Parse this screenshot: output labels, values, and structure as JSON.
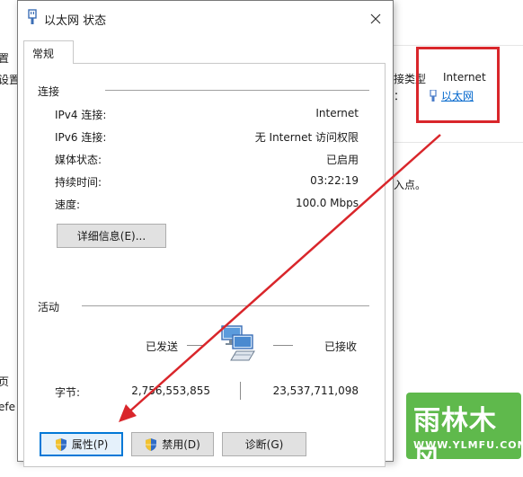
{
  "background": {
    "left_fragments": [
      "置",
      "设置"
    ],
    "left_lower_fragments": [
      "页",
      "efe"
    ],
    "right": {
      "type_label_fragment": "接类型",
      "colon_fragment": "：",
      "type_value": "Internet",
      "connection_link": "以太网",
      "hint_fragment": "入点。"
    }
  },
  "dialog": {
    "title": "以太网 状态",
    "tab": "常规",
    "connection": {
      "heading": "连接",
      "rows": [
        {
          "label": "IPv4 连接:",
          "value": "Internet"
        },
        {
          "label": "IPv6 连接:",
          "value": "无 Internet 访问权限"
        },
        {
          "label": "媒体状态:",
          "value": "已启用"
        },
        {
          "label": "持续时间:",
          "value": "03:22:19"
        },
        {
          "label": "速度:",
          "value": "100.0 Mbps"
        }
      ],
      "details_button": "详细信息(E)..."
    },
    "activity": {
      "heading": "活动",
      "sent_label": "已发送",
      "received_label": "已接收",
      "bytes_label": "字节:",
      "bytes_sent": "2,756,553,855",
      "bytes_received": "23,537,711,098"
    },
    "buttons": {
      "properties": "属性(P)",
      "disable": "禁用(D)",
      "diagnose": "诊断(G)"
    }
  },
  "watermark": {
    "top": "雨林木风",
    "bottom": "WWW.YLMFU.COM"
  },
  "colors": {
    "annotation_red": "#d9262b",
    "link_blue": "#0066cc",
    "focus_blue": "#0078d7",
    "watermark_green": "#5fb94c"
  }
}
